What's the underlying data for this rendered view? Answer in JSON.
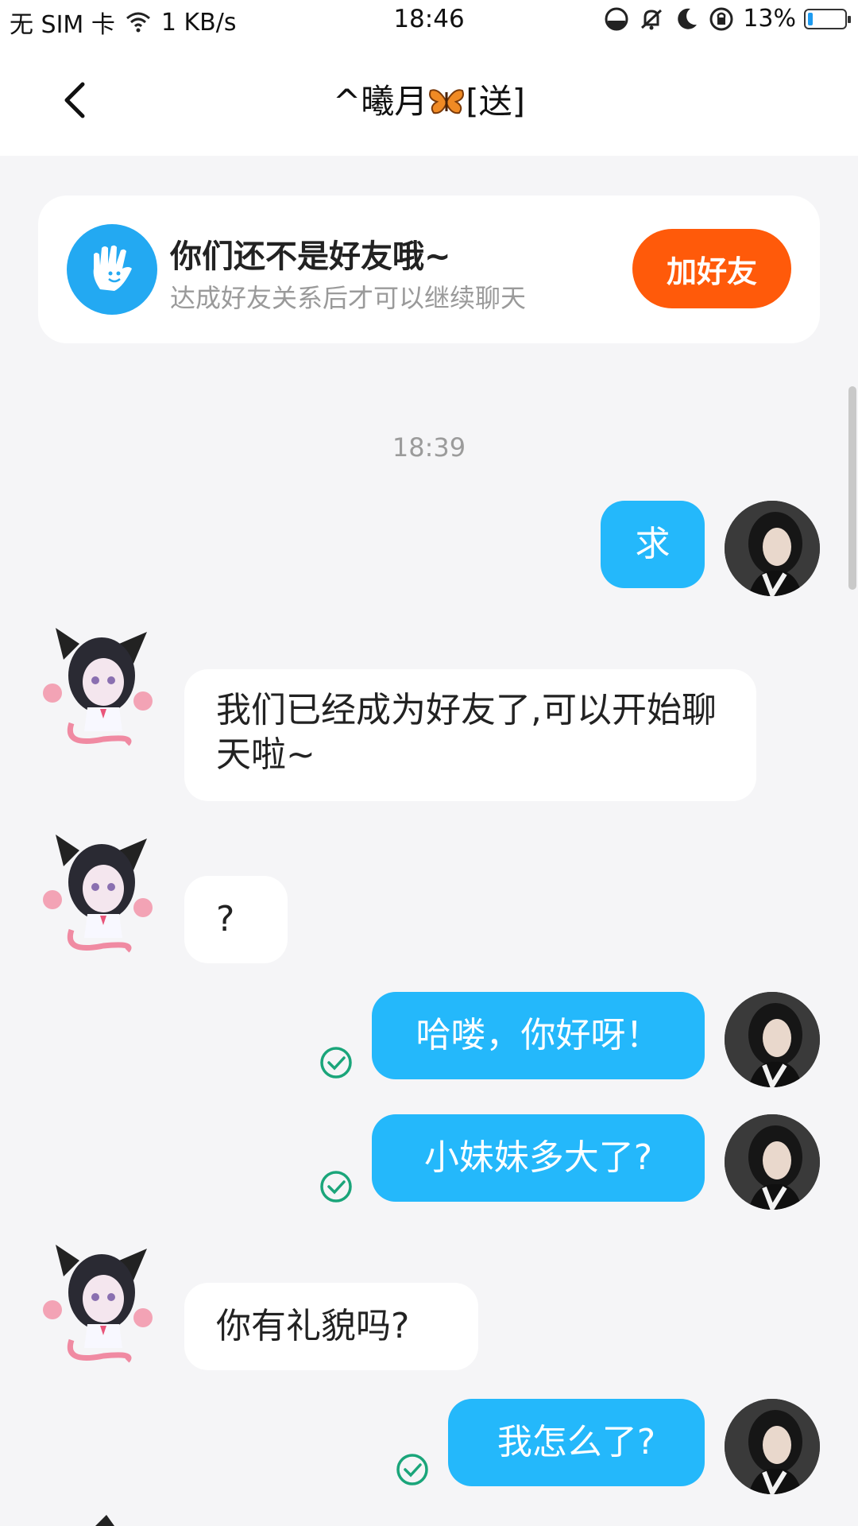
{
  "status_bar": {
    "carrier": "无 SIM 卡",
    "speed": "1 KB/s",
    "time": "18:46",
    "battery": "13%",
    "battery_level": 0.13,
    "icons": [
      "wifi-icon",
      "data-saver-icon",
      "mute-icon",
      "moon-icon",
      "rotation-lock-icon",
      "battery-icon"
    ]
  },
  "nav": {
    "title_prefix": "^曦月",
    "title_suffix": "[送]",
    "title_emoji": "butterfly"
  },
  "friend_notice": {
    "title": "你们还不是好友哦~",
    "subtitle": "达成好友关系后才可以继续聊天",
    "button": "加好友",
    "button_color": "#ff5a0a",
    "icon": "hand-icon"
  },
  "chat": {
    "timestamp": "18:39",
    "messages": [
      {
        "side": "me",
        "text": "求",
        "read": false
      },
      {
        "side": "other",
        "text": "我们已经成为好友了,可以开始聊天啦~"
      },
      {
        "side": "other",
        "text": "?"
      },
      {
        "side": "me",
        "text": "哈喽，你好呀！",
        "read": true
      },
      {
        "side": "me",
        "text": "小妹妹多大了?",
        "read": true
      },
      {
        "side": "other",
        "text": "你有礼貌吗?"
      },
      {
        "side": "me",
        "text": "我怎么了?",
        "read": true
      }
    ],
    "me_bubble_color": "#24b8fb",
    "read_check_color": "#1aa57a"
  }
}
